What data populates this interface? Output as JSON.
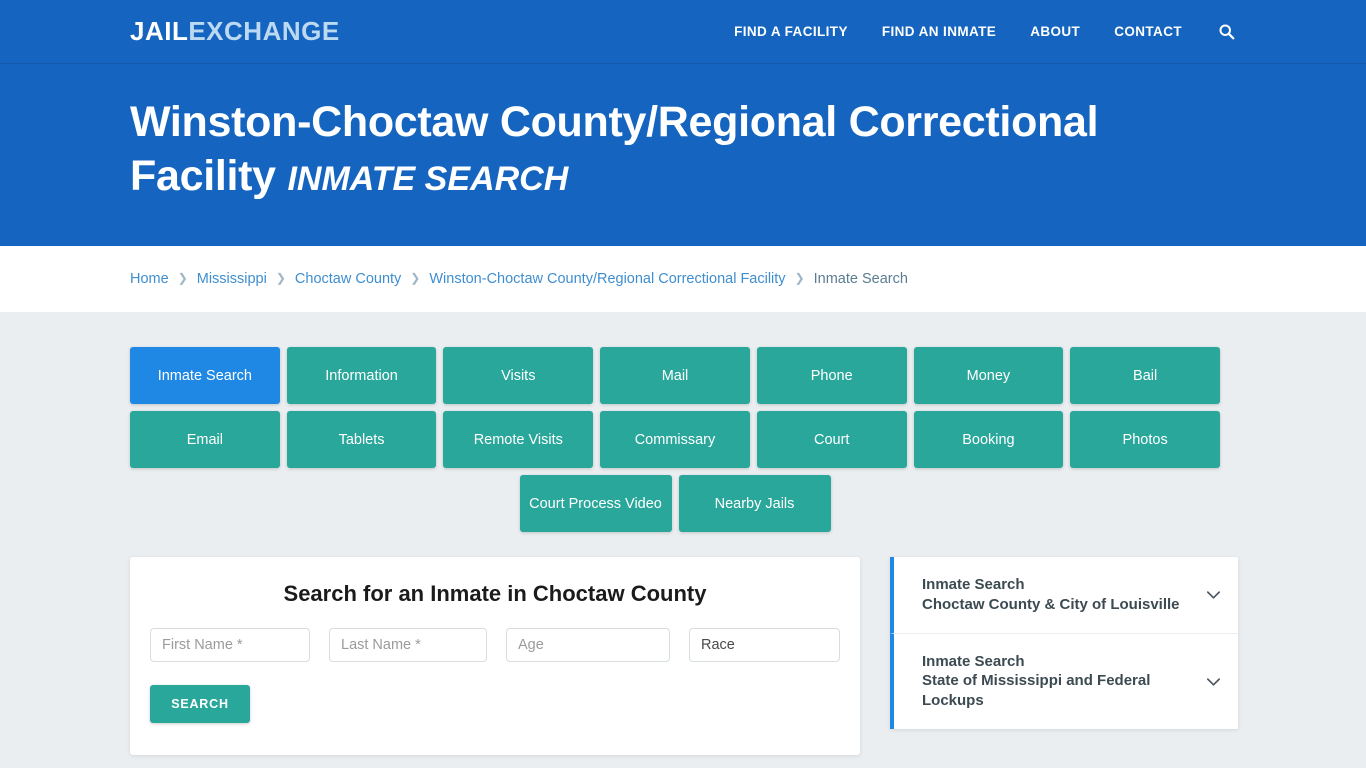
{
  "header": {
    "logo_primary": "JAIL",
    "logo_secondary": "EXCHANGE",
    "nav": [
      {
        "label": "FIND A FACILITY"
      },
      {
        "label": "FIND AN INMATE"
      },
      {
        "label": "ABOUT"
      },
      {
        "label": "CONTACT"
      }
    ],
    "search_icon": "search-icon",
    "bg_color": "#1565c0"
  },
  "hero": {
    "title": "Winston-Choctaw County/Regional Correctional Facility",
    "subtitle": "INMATE SEARCH"
  },
  "breadcrumb": {
    "items": [
      {
        "label": "Home",
        "current": false
      },
      {
        "label": "Mississippi",
        "current": false
      },
      {
        "label": "Choctaw County",
        "current": false
      },
      {
        "label": "Winston-Choctaw County/Regional Correctional Facility",
        "current": false
      },
      {
        "label": "Inmate Search",
        "current": true
      }
    ],
    "separator": "❯",
    "link_color": "#3f8ed0",
    "current_color": "#5b7c91"
  },
  "nav_buttons": {
    "active_color": "#1f88e5",
    "default_color": "#29a79b",
    "row1": [
      {
        "label": "Inmate Search",
        "active": true
      },
      {
        "label": "Information",
        "active": false
      },
      {
        "label": "Visits",
        "active": false
      },
      {
        "label": "Mail",
        "active": false
      },
      {
        "label": "Phone",
        "active": false
      },
      {
        "label": "Money",
        "active": false
      },
      {
        "label": "Bail",
        "active": false
      }
    ],
    "row2": [
      {
        "label": "Email",
        "active": false
      },
      {
        "label": "Tablets",
        "active": false
      },
      {
        "label": "Remote Visits",
        "active": false
      },
      {
        "label": "Commissary",
        "active": false
      },
      {
        "label": "Court",
        "active": false
      },
      {
        "label": "Booking",
        "active": false
      },
      {
        "label": "Photos",
        "active": false
      }
    ],
    "row3": [
      {
        "label": "Court Process Video",
        "active": false
      },
      {
        "label": "Nearby Jails",
        "active": false
      }
    ]
  },
  "search_form": {
    "heading": "Search for an Inmate in Choctaw County",
    "first_name": {
      "placeholder": "First Name *",
      "value": ""
    },
    "last_name": {
      "placeholder": "Last Name *",
      "value": ""
    },
    "age": {
      "placeholder": "Age",
      "value": ""
    },
    "race": {
      "selected": "Race",
      "options": [
        "Race"
      ]
    },
    "submit_label": "SEARCH",
    "submit_color": "#29a79b"
  },
  "sidebar": {
    "accent_color": "#1f88e5",
    "items": [
      {
        "title": "Inmate Search",
        "subtitle": "Choctaw County & City of Louisville",
        "icon": "chevron-down-icon"
      },
      {
        "title": "Inmate Search",
        "subtitle": "State of Mississippi and Federal Lockups",
        "icon": "chevron-down-icon"
      }
    ]
  }
}
